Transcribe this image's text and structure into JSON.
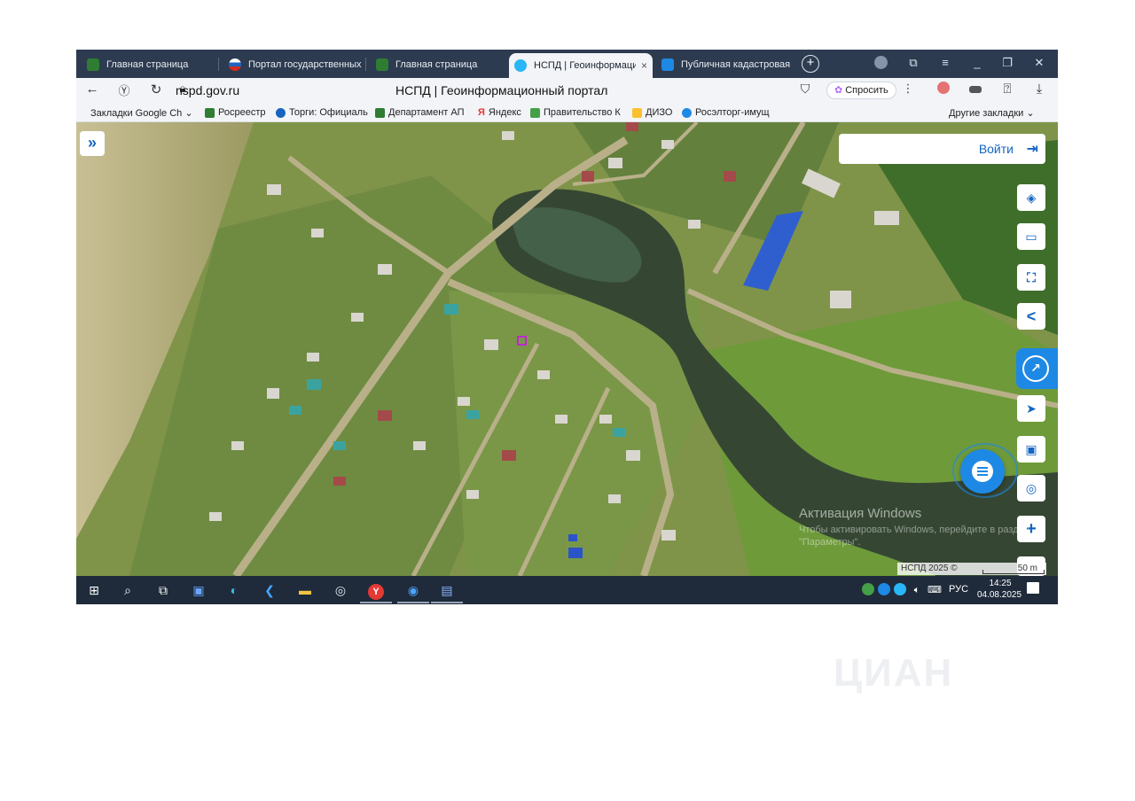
{
  "tabs": [
    {
      "label": "Главная страница",
      "color": "#2e7d32",
      "active": false
    },
    {
      "label": "Портал государственных",
      "color": "#c62828",
      "active": false
    },
    {
      "label": "Главная страница",
      "color": "#2e7d32",
      "active": false
    },
    {
      "label": "НСПД | Геоинформаци",
      "color": "#29b6f6",
      "active": true
    },
    {
      "label": "Публичная кадастровая",
      "color": "#1e88e5",
      "active": false
    }
  ],
  "address": {
    "url": "nspd.gov.ru",
    "page_title": "НСПД | Геоинформационный портал",
    "ask_button": "Спросить"
  },
  "bookmarks": {
    "items": [
      {
        "label": "Закладки Google Ch",
        "color": "#9e9e9e"
      },
      {
        "label": "Росреестр",
        "color": "#2e7d32"
      },
      {
        "label": "Торги: Официаль",
        "color": "#1565c0"
      },
      {
        "label": "Департамент АП",
        "color": "#2e7d32"
      },
      {
        "label": "Яндекс",
        "color": "#e53935"
      },
      {
        "label": "Правительство К",
        "color": "#43a047"
      },
      {
        "label": "ДИЗО",
        "color": "#fbc02d"
      },
      {
        "label": "Росэлторг-имущ",
        "color": "#1e88e5"
      }
    ],
    "other": "Другие закладки"
  },
  "map": {
    "login_label": "Войти",
    "expand_label": "»",
    "controls": [
      "layers-icon",
      "ruler-icon",
      "select-area-icon",
      "share-icon",
      "navigate-icon",
      "minimap-icon",
      "geolocate-icon",
      "zoom-in-icon"
    ],
    "zoom_in": "+",
    "watermark_title": "Активация Windows",
    "watermark_text": "Чтобы активировать Windows, перейдите в раздел \"Параметры\".",
    "scale_copy": "НСПД 2025 ©",
    "scale_value": "50 m"
  },
  "taskbar": {
    "language": "РУС",
    "time": "14:25",
    "date": "04.08.2025"
  },
  "cian_watermark": "ЦИАН",
  "colors": {
    "accent": "#1e88e5",
    "tabbar": "#2d3b50",
    "taskbar": "#1f2b3b"
  }
}
